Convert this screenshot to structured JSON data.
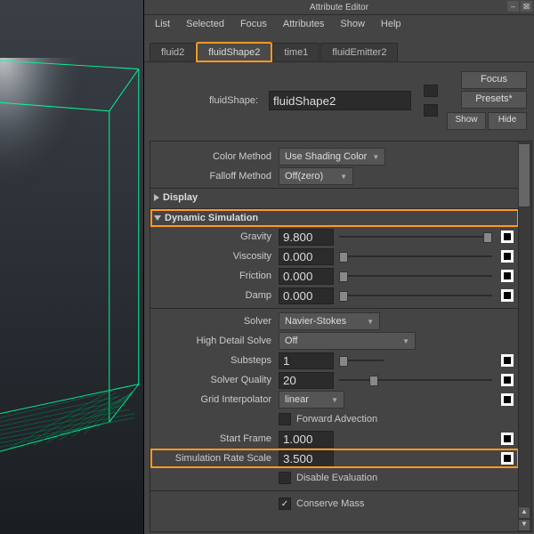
{
  "window": {
    "title": "Attribute Editor"
  },
  "menu": [
    "List",
    "Selected",
    "Focus",
    "Attributes",
    "Show",
    "Help"
  ],
  "tabs": [
    {
      "label": "fluid2",
      "active": false
    },
    {
      "label": "fluidShape2",
      "active": true,
      "highlight": true
    },
    {
      "label": "time1",
      "active": false
    },
    {
      "label": "fluidEmitter2",
      "active": false
    }
  ],
  "node": {
    "label": "fluidShape:",
    "value": "fluidShape2"
  },
  "buttons": {
    "focus": "Focus",
    "presets": "Presets*",
    "show": "Show",
    "hide": "Hide"
  },
  "attrs": {
    "colorMethod": {
      "label": "Color Method",
      "value": "Use Shading Color"
    },
    "falloffMethod": {
      "label": "Falloff Method",
      "value": "Off(zero)"
    }
  },
  "sections": {
    "display": "Display",
    "dynsim": "Dynamic Simulation"
  },
  "dynsim": {
    "gravity": {
      "label": "Gravity",
      "value": "9.800",
      "slider": 1.0
    },
    "viscosity": {
      "label": "Viscosity",
      "value": "0.000",
      "slider": 0.0
    },
    "friction": {
      "label": "Friction",
      "value": "0.000",
      "slider": 0.0
    },
    "damp": {
      "label": "Damp",
      "value": "0.000",
      "slider": 0.0
    },
    "solver": {
      "label": "Solver",
      "value": "Navier-Stokes"
    },
    "highDetail": {
      "label": "High Detail Solve",
      "value": "Off"
    },
    "substeps": {
      "label": "Substeps",
      "value": "1",
      "slider": 0.0
    },
    "solverQuality": {
      "label": "Solver Quality",
      "value": "20",
      "slider": 0.2
    },
    "gridInterp": {
      "label": "Grid Interpolator",
      "value": "linear"
    },
    "forwardAdvection": {
      "label": "Forward Advection",
      "checked": false
    },
    "startFrame": {
      "label": "Start Frame",
      "value": "1.000"
    },
    "simRateScale": {
      "label": "Simulation Rate Scale",
      "value": "3.500",
      "highlight": true
    },
    "disableEval": {
      "label": "Disable Evaluation",
      "checked": false
    },
    "conserveMass": {
      "label": "Conserve Mass",
      "checked": true
    }
  }
}
